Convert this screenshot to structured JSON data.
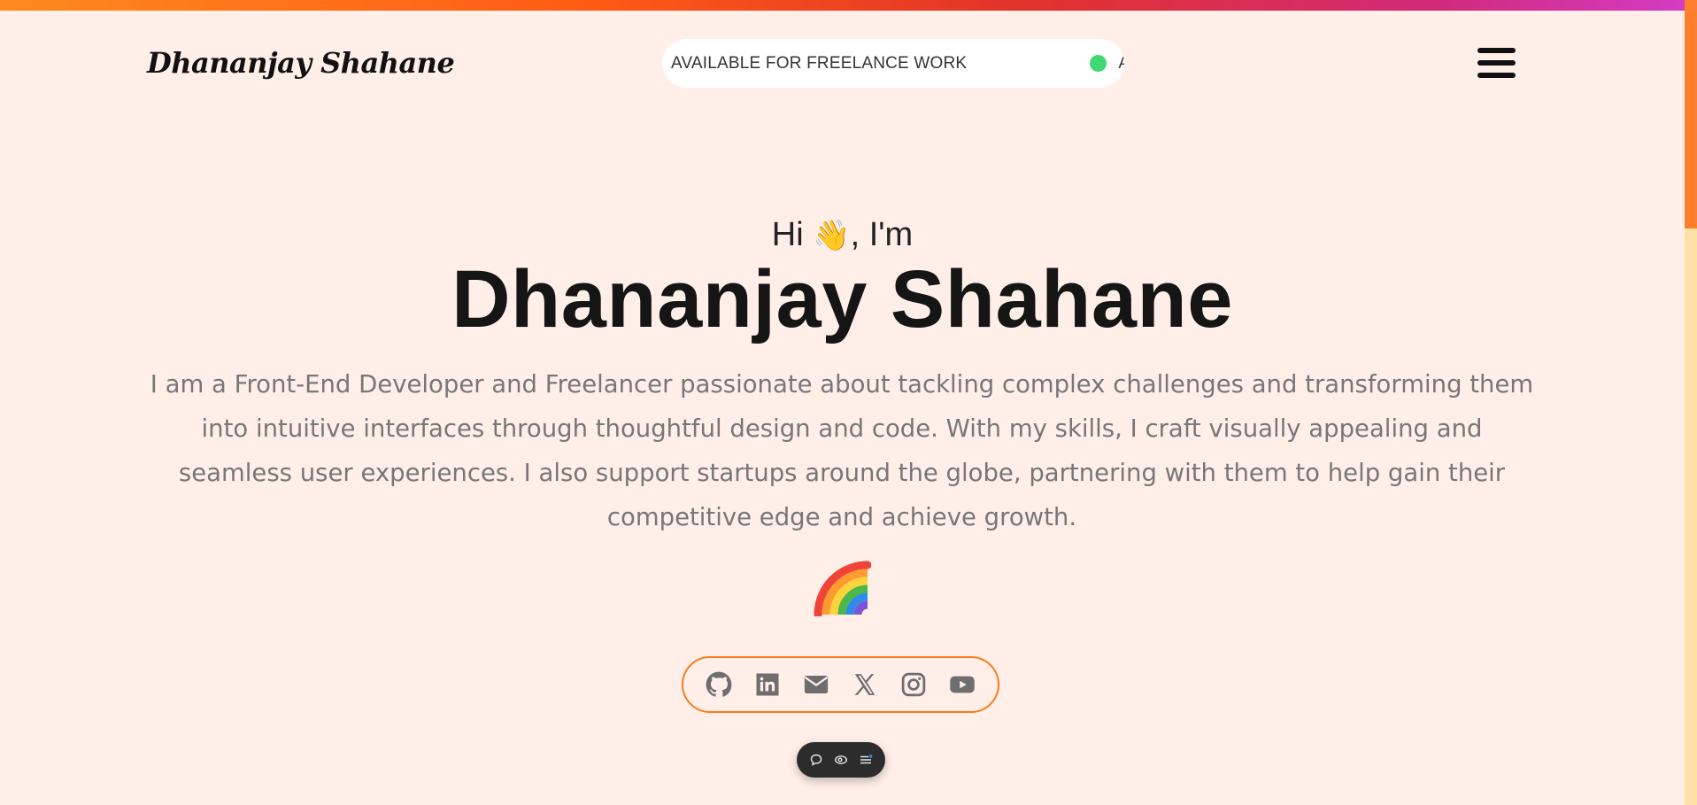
{
  "header": {
    "logo_text": "Dhananjay Shahane",
    "availability_text": "AVAILABLE FOR FREELANCE WORK",
    "availability_repeat_text": "A",
    "availability_color": "#3fd873",
    "menu_icon": "hamburger-menu-icon"
  },
  "hero": {
    "greeting_prefix": "Hi",
    "greeting_emoji": "👋",
    "greeting_suffix": ", I'm",
    "name": "Dhananjay Shahane",
    "bio": "I am a Front-End Developer and Freelancer passionate about tackling complex challenges and transforming them into intuitive interfaces through thoughtful design and code. With my skills, I craft visually appealing and seamless user experiences. I also support startups around the globe, partnering with them to help gain their competitive edge and achieve growth.",
    "decoration_icon": "rainbow-icon"
  },
  "social": [
    {
      "icon": "github-icon"
    },
    {
      "icon": "linkedin-icon"
    },
    {
      "icon": "email-icon"
    },
    {
      "icon": "x-twitter-icon"
    },
    {
      "icon": "instagram-icon"
    },
    {
      "icon": "youtube-icon"
    }
  ],
  "widget": {
    "buttons": [
      "comment-icon",
      "eye-icon",
      "list-icon"
    ]
  },
  "colors": {
    "background": "#ffefe8",
    "accent": "#ff7a1a",
    "text": "#151515",
    "muted": "#777777"
  }
}
